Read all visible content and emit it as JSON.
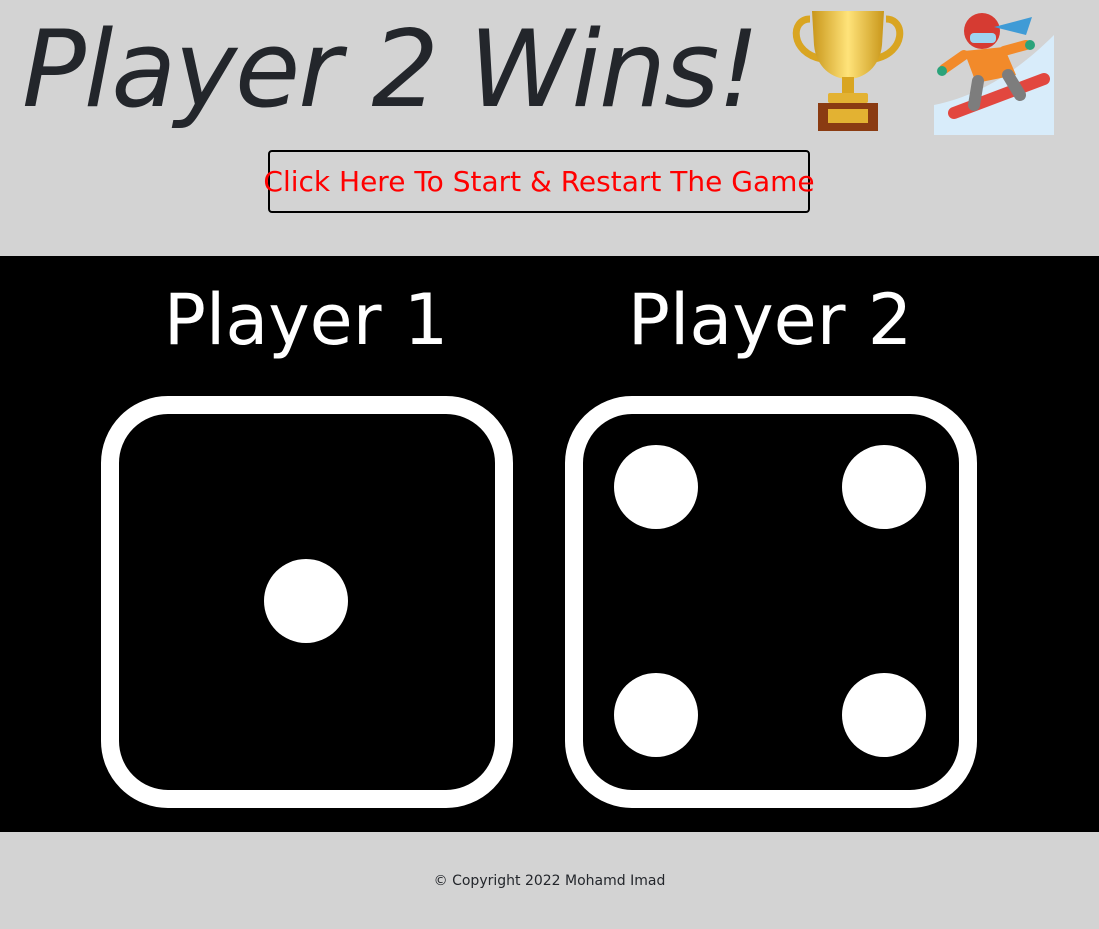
{
  "header": {
    "title": "Player 2 Wins!",
    "trophy_icon": "trophy-icon",
    "winner_icon": "snowboarder-icon",
    "start_button_label": "Click Here To Start & Restart The Game"
  },
  "game": {
    "players": [
      {
        "name": "Player 1",
        "dice_value": 1
      },
      {
        "name": "Player 2",
        "dice_value": 4
      }
    ]
  },
  "footer": {
    "copyright": "© Copyright 2022 Mohamd Imad"
  },
  "colors": {
    "page_background": "#d3d3d3",
    "game_background": "#000000",
    "button_text": "#ff0000",
    "dice_face": "#ffffff"
  }
}
